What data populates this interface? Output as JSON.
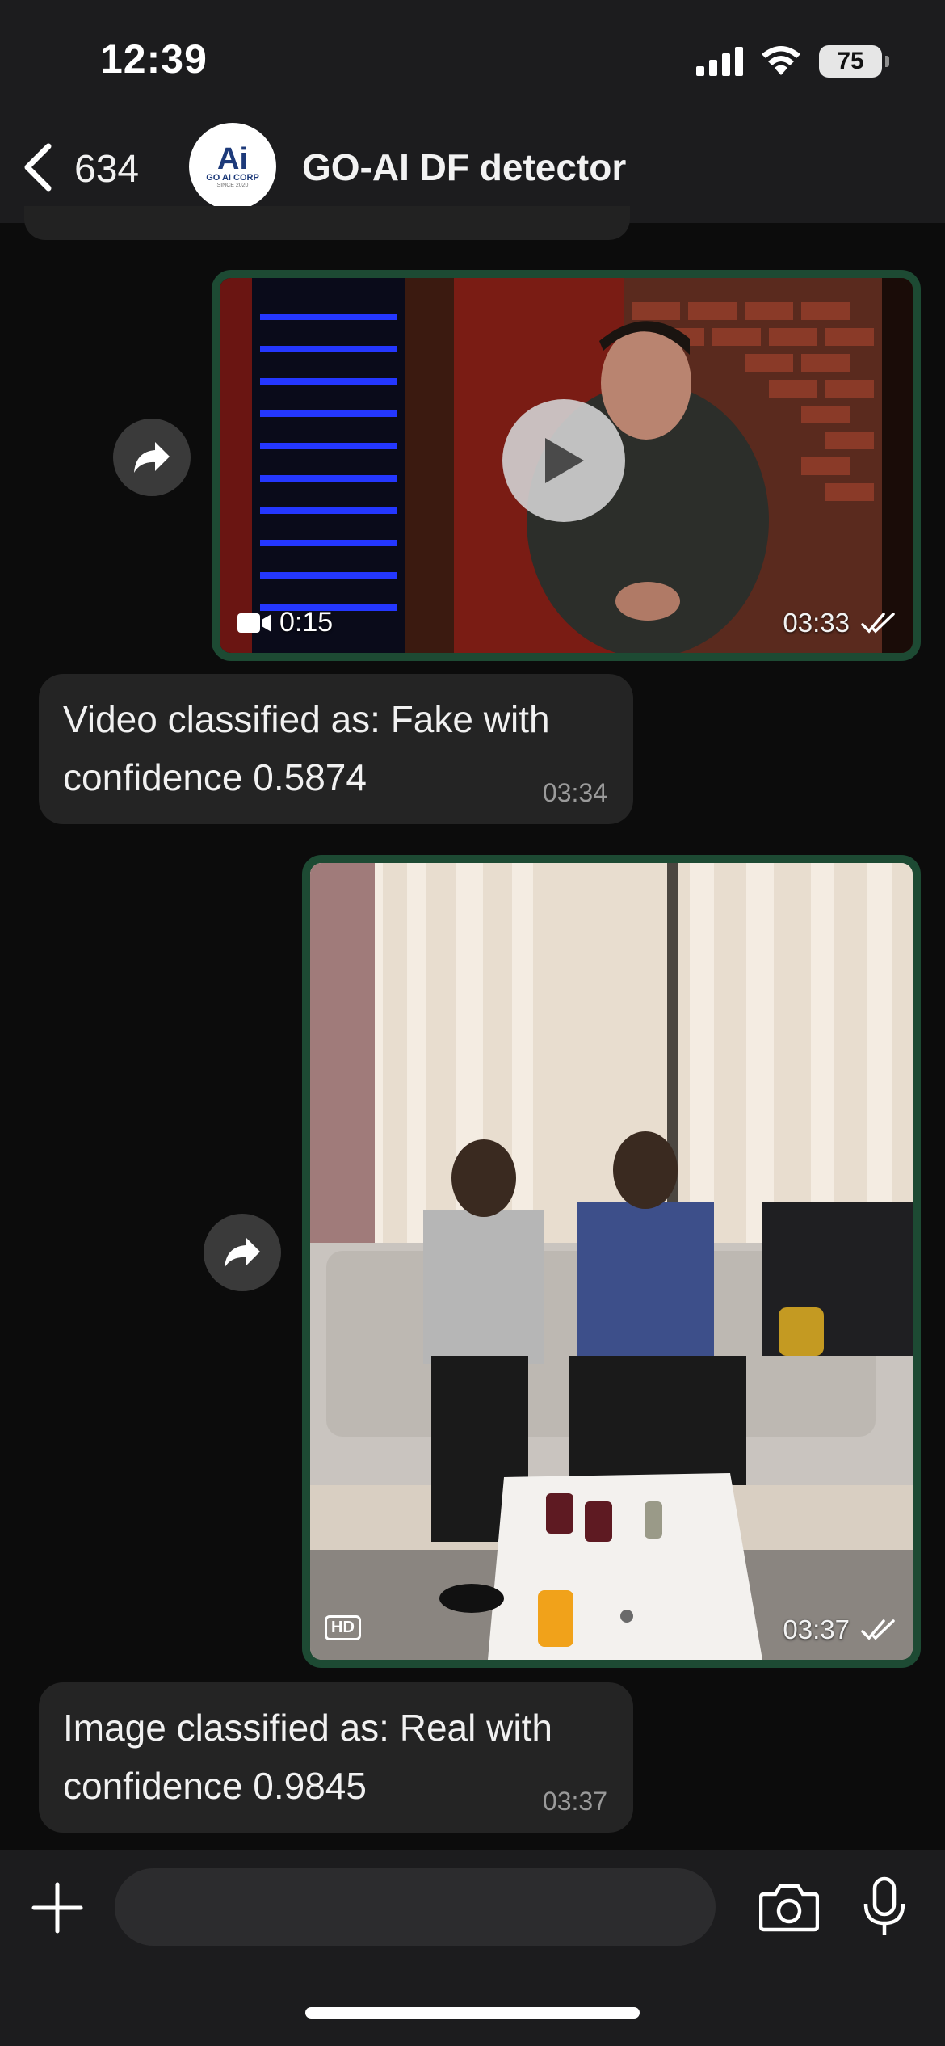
{
  "status_bar": {
    "time": "12:39",
    "battery": "75"
  },
  "header": {
    "back_count": "634",
    "title": "GO-AI DF detector",
    "avatar": {
      "text": "Ai",
      "corp": "GO AI CORP",
      "since": "SINCE 2020"
    }
  },
  "messages": [
    {
      "type": "video",
      "duration": "0:15",
      "time": "03:33",
      "status": "read"
    },
    {
      "type": "text",
      "text": "Video classified as: Fake with confidence 0.5874",
      "time": "03:34"
    },
    {
      "type": "image",
      "badge": "HD",
      "time": "03:37",
      "status": "read"
    },
    {
      "type": "text",
      "text": "Image classified as: Real with confidence 0.9845",
      "time": "03:37"
    }
  ],
  "composer": {
    "input_value": ""
  },
  "icons": [
    "signal-icon",
    "wifi-icon",
    "battery-icon",
    "back-chevron-icon",
    "forward-icon",
    "play-icon",
    "video-camera-icon",
    "double-check-icon",
    "hd-badge-icon",
    "plus-icon",
    "sticker-icon",
    "camera-icon",
    "mic-icon"
  ],
  "colors": {
    "chat_bg": "#0c0c0c",
    "bar": "#1c1c1e",
    "bubble": "#242424",
    "media_border": "#1d4a33"
  }
}
